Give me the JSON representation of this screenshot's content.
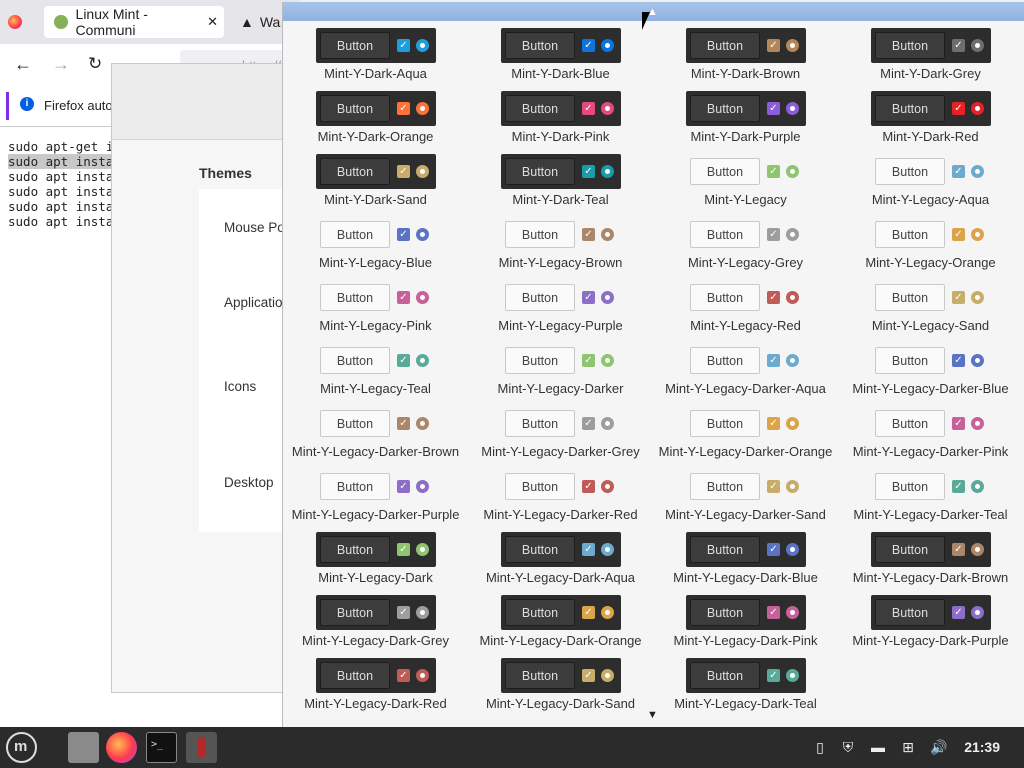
{
  "firefox": {
    "tab1_title": "",
    "tab2_title": "Linux Mint - Communi",
    "tab3_title": "Wa",
    "url_partial": "https://",
    "notification": "Firefox auto"
  },
  "terminal": {
    "lines": [
      "sudo apt-get in",
      "sudo apt insta",
      "sudo apt instal",
      "sudo apt instal",
      "sudo apt instal",
      "sudo apt instal"
    ]
  },
  "settings": {
    "section_title": "Themes",
    "rows": [
      "Mouse Po",
      "Applicatio",
      "Icons",
      "Desktop"
    ]
  },
  "popup": {
    "button_label": "Button",
    "themes": [
      {
        "name": "Mint-Y-Dark-Aqua",
        "style": "dark",
        "accent": "#1f9ede"
      },
      {
        "name": "Mint-Y-Dark-Blue",
        "style": "dark",
        "accent": "#0c75de"
      },
      {
        "name": "Mint-Y-Dark-Brown",
        "style": "dark",
        "accent": "#b5865c"
      },
      {
        "name": "Mint-Y-Dark-Grey",
        "style": "dark",
        "accent": "#6e6e6e"
      },
      {
        "name": "Mint-Y-Dark-Orange",
        "style": "dark",
        "accent": "#ff7139"
      },
      {
        "name": "Mint-Y-Dark-Pink",
        "style": "dark",
        "accent": "#e54980"
      },
      {
        "name": "Mint-Y-Dark-Purple",
        "style": "dark",
        "accent": "#8c5dd9"
      },
      {
        "name": "Mint-Y-Dark-Red",
        "style": "dark",
        "accent": "#e82127"
      },
      {
        "name": "Mint-Y-Dark-Sand",
        "style": "dark",
        "accent": "#c8ac69"
      },
      {
        "name": "Mint-Y-Dark-Teal",
        "style": "dark",
        "accent": "#199ca8"
      },
      {
        "name": "Mint-Y-Legacy",
        "style": "light",
        "accent": "#8fc470"
      },
      {
        "name": "Mint-Y-Legacy-Aqua",
        "style": "light",
        "accent": "#6cabcd"
      },
      {
        "name": "Mint-Y-Legacy-Blue",
        "style": "light",
        "accent": "#5b73c4"
      },
      {
        "name": "Mint-Y-Legacy-Brown",
        "style": "light",
        "accent": "#aa876a"
      },
      {
        "name": "Mint-Y-Legacy-Grey",
        "style": "light",
        "accent": "#9d9d9d"
      },
      {
        "name": "Mint-Y-Legacy-Orange",
        "style": "light",
        "accent": "#dba448"
      },
      {
        "name": "Mint-Y-Legacy-Pink",
        "style": "light",
        "accent": "#c76199"
      },
      {
        "name": "Mint-Y-Legacy-Purple",
        "style": "light",
        "accent": "#8c6ec9"
      },
      {
        "name": "Mint-Y-Legacy-Red",
        "style": "light",
        "accent": "#c15b58"
      },
      {
        "name": "Mint-Y-Legacy-Sand",
        "style": "light",
        "accent": "#c8ac69"
      },
      {
        "name": "Mint-Y-Legacy-Teal",
        "style": "light",
        "accent": "#5aaa9a"
      },
      {
        "name": "Mint-Y-Legacy-Darker",
        "style": "light",
        "accent": "#8fc470"
      },
      {
        "name": "Mint-Y-Legacy-Darker-Aqua",
        "style": "light",
        "accent": "#6cabcd"
      },
      {
        "name": "Mint-Y-Legacy-Darker-Blue",
        "style": "light",
        "accent": "#5b73c4"
      },
      {
        "name": "Mint-Y-Legacy-Darker-Brown",
        "style": "light",
        "accent": "#aa876a"
      },
      {
        "name": "Mint-Y-Legacy-Darker-Grey",
        "style": "light",
        "accent": "#9d9d9d"
      },
      {
        "name": "Mint-Y-Legacy-Darker-Orange",
        "style": "light",
        "accent": "#dba448"
      },
      {
        "name": "Mint-Y-Legacy-Darker-Pink",
        "style": "light",
        "accent": "#c76199"
      },
      {
        "name": "Mint-Y-Legacy-Darker-Purple",
        "style": "light",
        "accent": "#8c6ec9"
      },
      {
        "name": "Mint-Y-Legacy-Darker-Red",
        "style": "light",
        "accent": "#c15b58"
      },
      {
        "name": "Mint-Y-Legacy-Darker-Sand",
        "style": "light",
        "accent": "#c8ac69"
      },
      {
        "name": "Mint-Y-Legacy-Darker-Teal",
        "style": "light",
        "accent": "#5aaa9a"
      },
      {
        "name": "Mint-Y-Legacy-Dark",
        "style": "dark",
        "accent": "#8fc470"
      },
      {
        "name": "Mint-Y-Legacy-Dark-Aqua",
        "style": "dark",
        "accent": "#6cabcd"
      },
      {
        "name": "Mint-Y-Legacy-Dark-Blue",
        "style": "dark",
        "accent": "#5b73c4"
      },
      {
        "name": "Mint-Y-Legacy-Dark-Brown",
        "style": "dark",
        "accent": "#aa876a"
      },
      {
        "name": "Mint-Y-Legacy-Dark-Grey",
        "style": "dark",
        "accent": "#9d9d9d"
      },
      {
        "name": "Mint-Y-Legacy-Dark-Orange",
        "style": "dark",
        "accent": "#dba448"
      },
      {
        "name": "Mint-Y-Legacy-Dark-Pink",
        "style": "dark",
        "accent": "#c76199"
      },
      {
        "name": "Mint-Y-Legacy-Dark-Purple",
        "style": "dark",
        "accent": "#8c6ec9"
      },
      {
        "name": "Mint-Y-Legacy-Dark-Red",
        "style": "dark",
        "accent": "#c15b58"
      },
      {
        "name": "Mint-Y-Legacy-Dark-Sand",
        "style": "dark",
        "accent": "#c8ac69"
      },
      {
        "name": "Mint-Y-Legacy-Dark-Teal",
        "style": "dark",
        "accent": "#5aaa9a"
      }
    ]
  },
  "taskbar": {
    "clock": "21:39",
    "items": [
      "mint-menu-icon",
      "file-manager-icon",
      "firefox-icon",
      "terminal-icon",
      "settings-icon"
    ]
  }
}
